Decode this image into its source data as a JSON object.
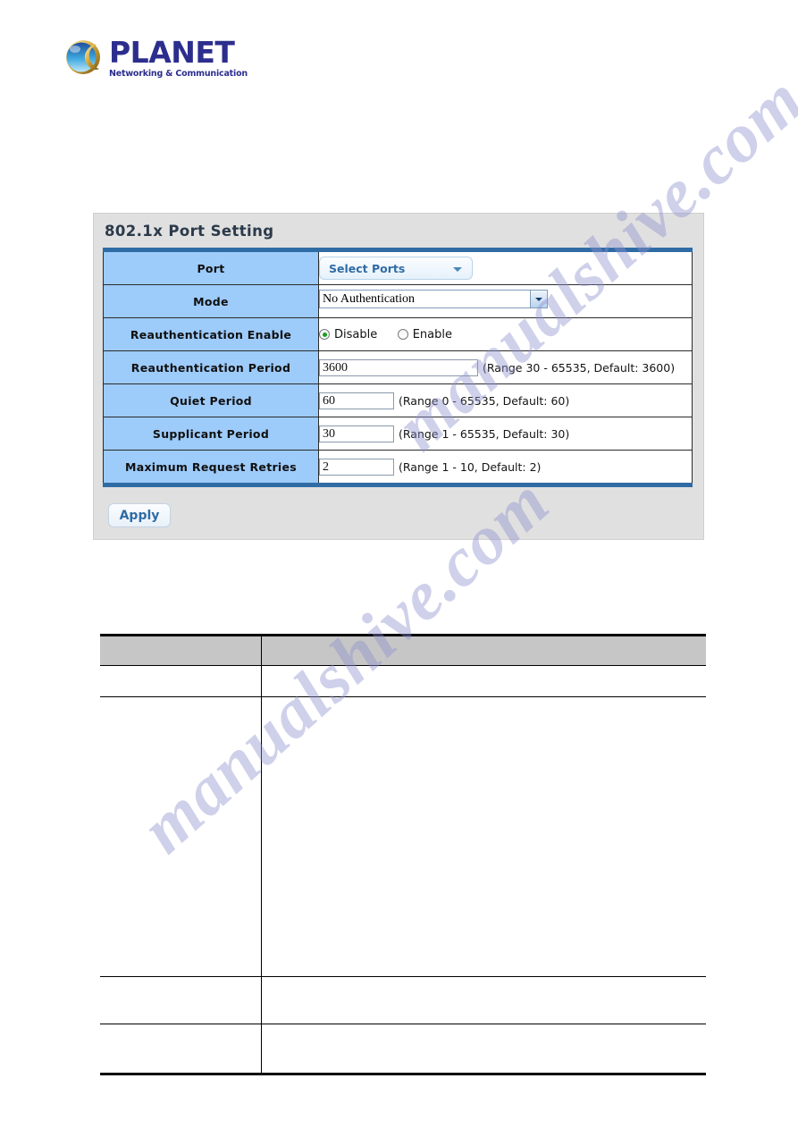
{
  "logo": {
    "brand": "PLANET",
    "tagline": "Networking & Communication",
    "mark": "planet-globe-icon"
  },
  "watermark": {
    "line1": "manualshive.com",
    "line2": "manualshive.com",
    "color": "#8f90cf"
  },
  "panel": {
    "title": "802.1x Port Setting",
    "accent_color": "#2f6ca5",
    "label_bg": "#9dcbfa",
    "apply_label": "Apply"
  },
  "form": {
    "rows": [
      {
        "label": "Port",
        "control": "port-select",
        "value": "Select Ports",
        "hint": ""
      },
      {
        "label": "Mode",
        "control": "mode-select",
        "value": "No Authentication",
        "hint": ""
      },
      {
        "label": "Reauthentication Enable",
        "control": "radio",
        "options": [
          {
            "label": "Disable",
            "selected": true
          },
          {
            "label": "Enable",
            "selected": false
          }
        ],
        "hint": ""
      },
      {
        "label": "Reauthentication Period",
        "control": "text-wide",
        "value": "3600",
        "hint": "(Range 30 - 65535, Default: 3600)"
      },
      {
        "label": "Quiet Period",
        "control": "text-narrow",
        "value": "60",
        "hint": "(Range 0 - 65535, Default: 60)"
      },
      {
        "label": "Supplicant Period",
        "control": "text-narrow",
        "value": "30",
        "hint": "(Range 1 - 65535, Default: 30)"
      },
      {
        "label": "Maximum Request Retries",
        "control": "text-narrow",
        "value": "2",
        "hint": "(Range 1 - 10, Default: 2)"
      }
    ]
  },
  "description_table": {
    "header": {
      "object": "",
      "description": ""
    },
    "rows": [
      {
        "object": "",
        "description": ""
      },
      {
        "object": "",
        "description": ""
      },
      {
        "object": "",
        "description": ""
      },
      {
        "object": "",
        "description": ""
      }
    ]
  }
}
